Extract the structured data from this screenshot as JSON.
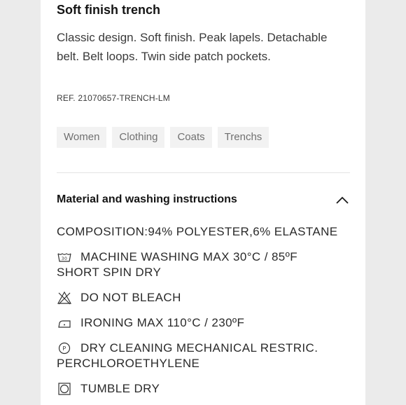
{
  "product": {
    "title": "Soft finish trench",
    "description": "Classic design. Soft finish. Peak lapels. Detachable belt. Belt loops. Twin side patch pockets.",
    "reference": "REF. 21070657-TRENCH-LM"
  },
  "tags": [
    "Women",
    "Clothing",
    "Coats",
    "Trenchs"
  ],
  "materials": {
    "header": "Material and washing instructions",
    "expanded": true,
    "composition": "COMPOSITION:94% POLYESTER,6% ELASTANE",
    "care": [
      {
        "icon": "wash-30-icon",
        "text": "MACHINE WASHING MAX 30°C / 85ºF",
        "text2": "SHORT SPIN DRY"
      },
      {
        "icon": "do-not-bleach-icon",
        "text": "DO NOT BLEACH"
      },
      {
        "icon": "iron-icon",
        "text": "IRONING MAX 110°C / 230ºF"
      },
      {
        "icon": "dry-clean-p-icon",
        "text": "DRY CLEANING MECHANICAL RESTRIC.",
        "text2": "PERCHLOROETHYLENE"
      },
      {
        "icon": "tumble-dry-icon",
        "text": "TUMBLE DRY"
      }
    ]
  }
}
